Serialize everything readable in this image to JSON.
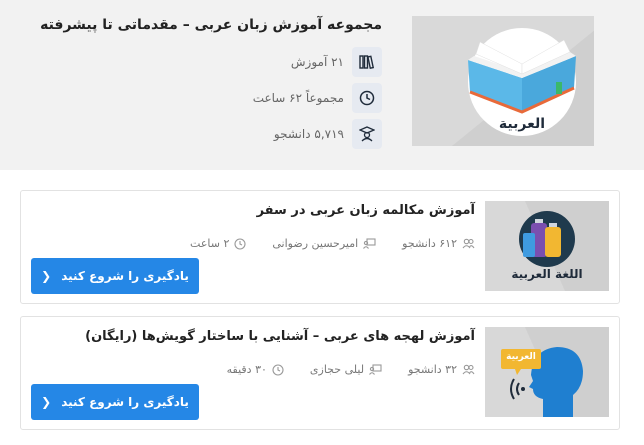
{
  "header": {
    "title": "مجموعه آموزش زبان عربی – مقدماتی تا پیشرفته",
    "image_label": "العربية",
    "stats": {
      "lessons": "۲۱ آموزش",
      "duration": "مجموعاً ۶۲ ساعت",
      "students": "۵,۷۱۹ دانشجو"
    }
  },
  "courses": [
    {
      "title": "آموزش مکالمه زبان عربی در سفر",
      "image_label": "اللغة العربية",
      "students": "۶۱۲ دانشجو",
      "teacher": "امیرحسین رضوانی",
      "duration": "۲ ساعت",
      "cta": "یادگیری را شروع کنید"
    },
    {
      "title": "آموزش لهجه های عربی – آشنایی با ساختار گویش‌ها (رایگان)",
      "image_label": "العربية",
      "students": "۳۲ دانشجو",
      "teacher": "لیلی حجازی",
      "duration": "۳۰ دقیقه",
      "cta": "یادگیری را شروع کنید"
    }
  ],
  "colors": {
    "accent": "#2587e6",
    "header_bg": "#f2f2f2",
    "icon_box": "#e6eaf1"
  }
}
